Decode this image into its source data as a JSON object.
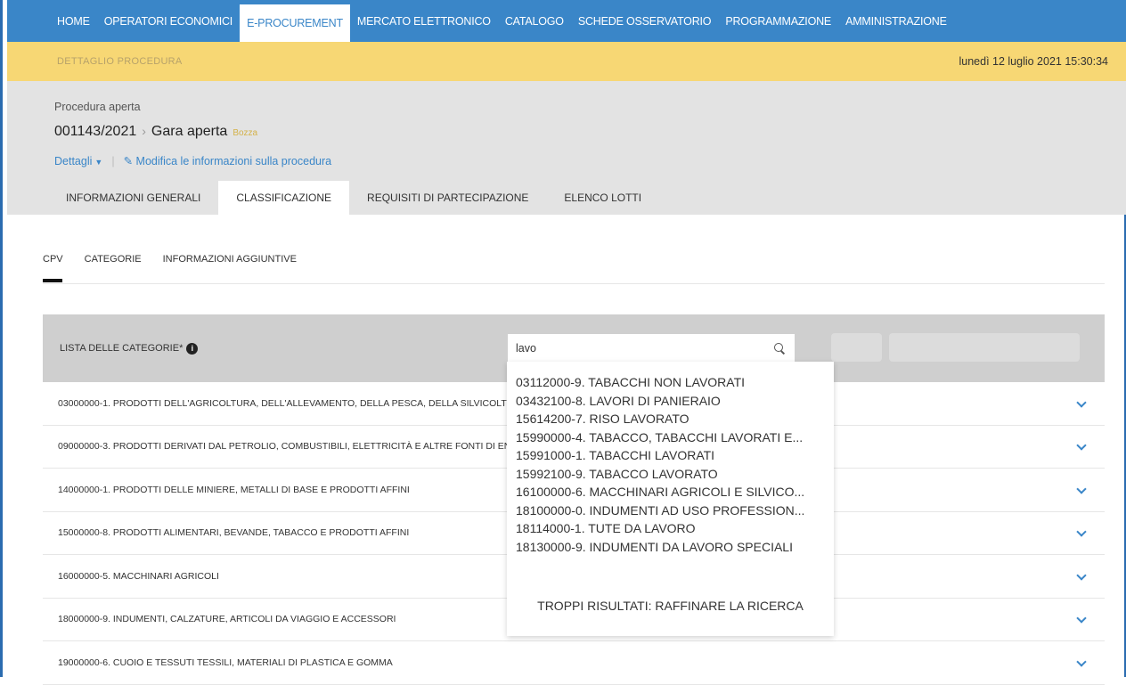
{
  "nav": {
    "items": [
      "HOME",
      "OPERATORI ECONOMICI",
      "E-PROCUREMENT",
      "MERCATO ELETTRONICO",
      "CATALOGO",
      "SCHEDE OSSERVATORIO",
      "PROGRAMMAZIONE",
      "AMMINISTRAZIONE"
    ],
    "active_index": 2
  },
  "subbar": {
    "breadcrumb": "DETTAGLIO PROCEDURA",
    "datetime": "lunedì 12 luglio 2021 15:30:34"
  },
  "procedure": {
    "type": "Procedura aperta",
    "number": "001143/2021",
    "title": "Gara aperta",
    "status": "Bozza",
    "details_link": "Dettagli",
    "edit_link": "Modifica le informazioni sulla procedura"
  },
  "tabs": [
    "INFORMAZIONI GENERALI",
    "CLASSIFICAZIONE",
    "REQUISITI DI PARTECIPAZIONE",
    "ELENCO LOTTI"
  ],
  "active_tab": 1,
  "subtabs": [
    "CPV",
    "CATEGORIE",
    "INFORMAZIONI AGGIUNTIVE"
  ],
  "categories": {
    "label": "LISTA DELLE CATEGORIE*",
    "search_value": "lavo",
    "rows": [
      "03000000-1. PRODOTTI DELL'AGRICOLTURA, DELL'ALLEVAMENTO, DELLA PESCA, DELLA SILVICOLTURA E PRODOTTI AFFINI",
      "09000000-3. PRODOTTI DERIVATI DAL PETROLIO, COMBUSTIBILI, ELETTRICITÀ E ALTRE FONTI DI ENERGIA",
      "14000000-1. PRODOTTI DELLE MINIERE, METALLI DI BASE E PRODOTTI AFFINI",
      "15000000-8. PRODOTTI ALIMENTARI, BEVANDE, TABACCO E PRODOTTI AFFINI",
      "16000000-5. MACCHINARI AGRICOLI",
      "18000000-9. INDUMENTI, CALZATURE, ARTICOLI DA VIAGGIO E ACCESSORI",
      "19000000-6. CUOIO E TESSUTI TESSILI, MATERIALI DI PLASTICA E GOMMA"
    ]
  },
  "dropdown": {
    "options": [
      "03112000-9. TABACCHI NON LAVORATI",
      "03432100-8. LAVORI DI PANIERAIO",
      "15614200-7. RISO LAVORATO",
      "15990000-4. TABACCO, TABACCHI LAVORATI E...",
      "15991000-1. TABACCHI LAVORATI",
      "15992100-9. TABACCO LAVORATO",
      "16100000-6. MACCHINARI AGRICOLI E SILVICO...",
      "18100000-0. INDUMENTI AD USO PROFESSION...",
      "18114000-1. TUTE DA LAVORO",
      "18130000-9. INDUMENTI DA LAVORO SPECIALI"
    ],
    "more": "TROPPI RISULTATI: RAFFINARE LA RICERCA"
  },
  "colors": {
    "nav": "#3a86c8",
    "subbar": "#f7d774",
    "accent": "#3a86c8"
  }
}
